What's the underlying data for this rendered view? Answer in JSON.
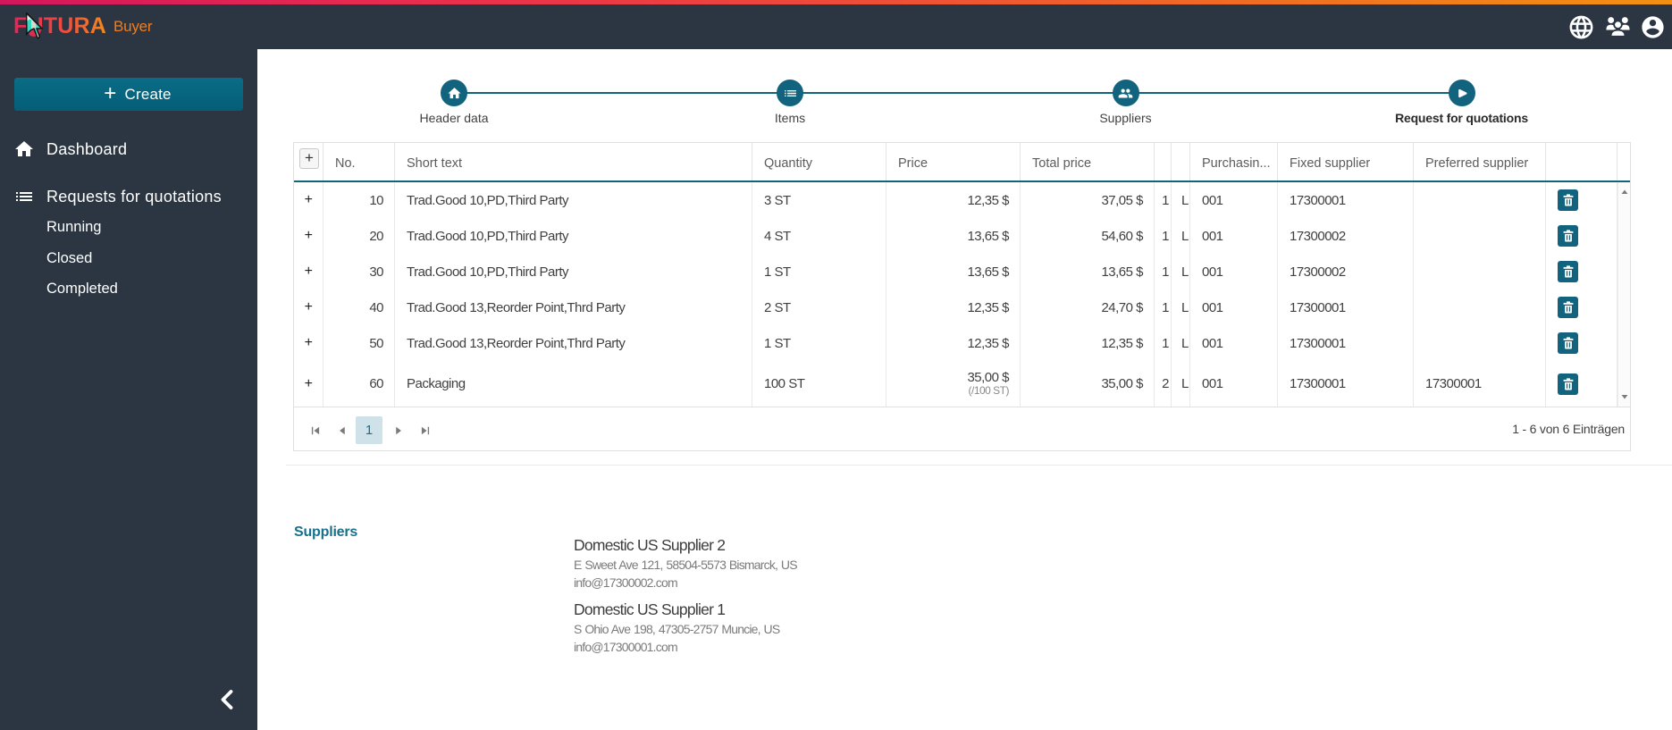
{
  "header": {
    "brand": "FUTURA",
    "product": "Buyer",
    "icons": [
      "language-icon",
      "groups-icon",
      "account-circle-icon"
    ]
  },
  "sidebar": {
    "create_label": "Create",
    "items": [
      {
        "label": "Dashboard",
        "icon": "home-icon"
      },
      {
        "label": "Requests for quotations",
        "icon": "list-icon"
      }
    ],
    "subitems": [
      {
        "label": "Running"
      },
      {
        "label": "Closed"
      },
      {
        "label": "Completed"
      }
    ]
  },
  "stepper": {
    "steps": [
      {
        "label": "Header data",
        "icon": "home-icon",
        "active": false
      },
      {
        "label": "Items",
        "icon": "list-icon",
        "active": false
      },
      {
        "label": "Suppliers",
        "icon": "people-icon",
        "active": false
      },
      {
        "label": "Request for quotations",
        "icon": "play-icon",
        "active": true
      }
    ]
  },
  "table": {
    "columns": [
      "",
      "No.",
      "Short text",
      "Quantity",
      "Price",
      "Total price",
      "",
      "",
      "Purchasin...",
      "Fixed supplier",
      "Preferred supplier",
      ""
    ],
    "rows": [
      {
        "no": "10",
        "short_text": "Trad.Good 10,PD,Third Party",
        "quantity": "3 ST",
        "price": "12,35 $",
        "price_sub": "",
        "total": "37,05 $",
        "col1": "1",
        "col2": "L",
        "purchasing": "001",
        "fixed_supplier": "17300001",
        "preferred_supplier": ""
      },
      {
        "no": "20",
        "short_text": "Trad.Good 10,PD,Third Party",
        "quantity": "4 ST",
        "price": "13,65 $",
        "price_sub": "",
        "total": "54,60 $",
        "col1": "1",
        "col2": "L",
        "purchasing": "001",
        "fixed_supplier": "17300002",
        "preferred_supplier": ""
      },
      {
        "no": "30",
        "short_text": "Trad.Good 10,PD,Third Party",
        "quantity": "1 ST",
        "price": "13,65 $",
        "price_sub": "",
        "total": "13,65 $",
        "col1": "1",
        "col2": "L",
        "purchasing": "001",
        "fixed_supplier": "17300002",
        "preferred_supplier": ""
      },
      {
        "no": "40",
        "short_text": "Trad.Good 13,Reorder Point,Thrd Party",
        "quantity": "2 ST",
        "price": "12,35 $",
        "price_sub": "",
        "total": "24,70 $",
        "col1": "1",
        "col2": "L",
        "purchasing": "001",
        "fixed_supplier": "17300001",
        "preferred_supplier": ""
      },
      {
        "no": "50",
        "short_text": "Trad.Good 13,Reorder Point,Thrd Party",
        "quantity": "1 ST",
        "price": "12,35 $",
        "price_sub": "",
        "total": "12,35 $",
        "col1": "1",
        "col2": "L",
        "purchasing": "001",
        "fixed_supplier": "17300001",
        "preferred_supplier": ""
      },
      {
        "no": "60",
        "short_text": "Packaging",
        "quantity": "100 ST",
        "price": "35,00 $",
        "price_sub": "(/100 ST)",
        "total": "35,00 $",
        "col1": "2",
        "col2": "L",
        "purchasing": "001",
        "fixed_supplier": "17300001",
        "preferred_supplier": "17300001"
      }
    ],
    "pagination": {
      "current_page": "1",
      "info": "1 - 6 von 6 Einträgen"
    }
  },
  "suppliers": {
    "heading": "Suppliers",
    "entries": [
      {
        "name": "Domestic US Supplier 2",
        "address": "E Sweet Ave 121, 58504-5573 Bismarck, US",
        "email": "info@17300002.com"
      },
      {
        "name": "Domestic US Supplier 1",
        "address": "S Ohio Ave 198, 47305-2757 Muncie, US",
        "email": "info@17300001.com"
      }
    ]
  }
}
